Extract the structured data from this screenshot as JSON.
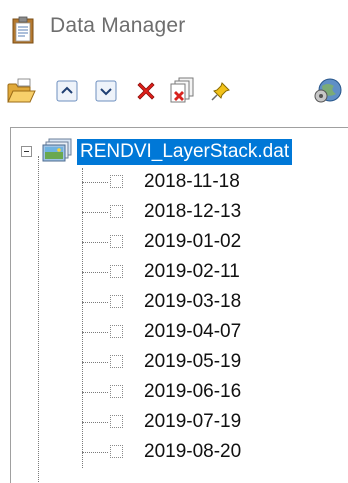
{
  "window": {
    "title": "Data Manager",
    "icon": "clipboard-icon"
  },
  "toolbar": {
    "buttons": [
      {
        "name": "open-file-button",
        "icon": "folder-open-icon"
      },
      {
        "name": "move-up-button",
        "icon": "arrow-up-icon"
      },
      {
        "name": "move-down-button",
        "icon": "arrow-down-icon"
      },
      {
        "name": "close-file-button",
        "icon": "red-x-icon"
      },
      {
        "name": "close-all-button",
        "icon": "close-multiple-icon"
      },
      {
        "name": "pin-button",
        "icon": "pin-icon"
      },
      {
        "name": "options-button",
        "icon": "globe-gear-icon"
      }
    ]
  },
  "tree": {
    "root": {
      "label": "RENDVI_LayerStack.dat",
      "expanded": true,
      "selected": true,
      "icon": "raster-stack-icon"
    },
    "bands": [
      {
        "label": "2018-11-18"
      },
      {
        "label": "2018-12-13"
      },
      {
        "label": "2019-01-02"
      },
      {
        "label": "2019-02-11"
      },
      {
        "label": "2019-03-18"
      },
      {
        "label": "2019-04-07"
      },
      {
        "label": "2019-05-19"
      },
      {
        "label": "2019-06-16"
      },
      {
        "label": "2019-07-19"
      },
      {
        "label": "2019-08-20"
      }
    ]
  },
  "colors": {
    "selection": "#0078d7",
    "title_text": "#6e6e6e"
  }
}
